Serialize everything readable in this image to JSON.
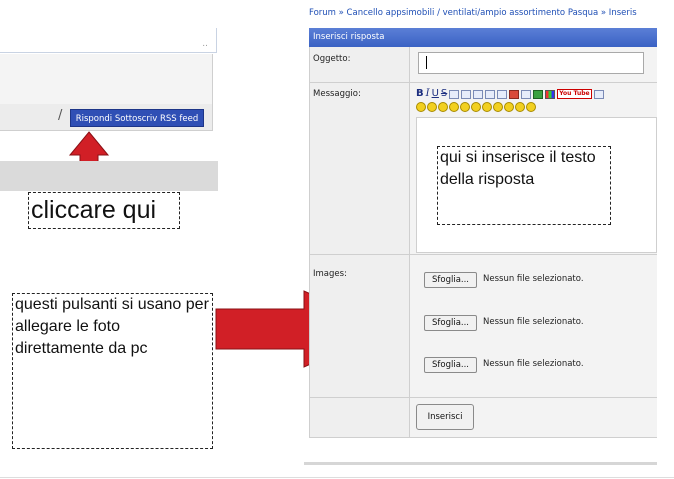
{
  "left_snippet": {
    "ellipsis": "..",
    "separator": "/",
    "action_buttons": "Rispondi Sottoscriv RSS feed"
  },
  "notes": {
    "click_here": "cliccare qui",
    "attach_photos": "questi pulsanti si usano per allegare le foto direttamente da pc",
    "message_text": "qui si inserisce il testo della risposta"
  },
  "forum": {
    "breadcrumb": "Forum » Cancello appsimobili / ventilati/ampio assortimento Pasqua » Inseris",
    "panel_title": "Inserisci risposta",
    "subject_label": "Oggetto:",
    "message_label": "Messaggio:",
    "images_label": "Images:",
    "toolbar_buttons": [
      "B",
      "I",
      "U",
      "S"
    ],
    "youtube_badge": "You Tube",
    "smiley_count": 11,
    "file_inputs": [
      {
        "button": "Sfoglia...",
        "status": "Nessun file selezionato."
      },
      {
        "button": "Sfoglia...",
        "status": "Nessun file selezionato."
      },
      {
        "button": "Sfoglia...",
        "status": "Nessun file selezionato."
      }
    ],
    "submit_label": "Inserisci"
  },
  "colors": {
    "arrow_red": "#d11f26",
    "header_blue": "#3a62c4",
    "button_blue": "#2f4fb5"
  }
}
